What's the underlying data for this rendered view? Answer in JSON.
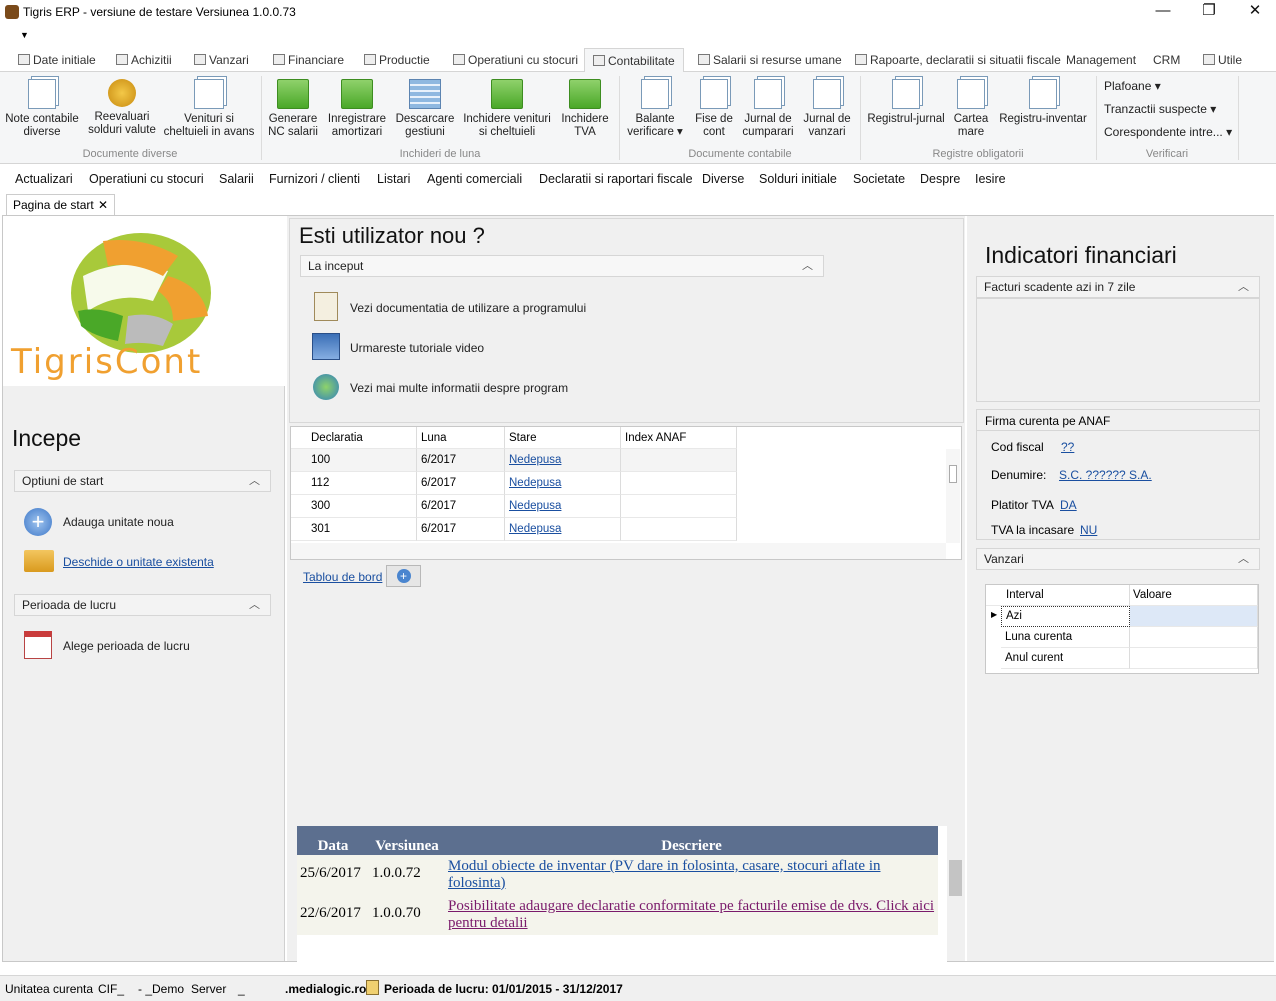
{
  "window": {
    "title": "Tigris ERP - versiune de testare Versiunea 1.0.0.73",
    "min": "—",
    "max": "❐",
    "close": "✕"
  },
  "ribbon_tabs": [
    "Date initiale",
    "Achizitii",
    "Vanzari",
    "Financiare",
    "Productie",
    "Operatiuni cu stocuri",
    "Contabilitate",
    "Salarii si resurse umane",
    "Rapoarte, declaratii si situatii fiscale",
    "Management",
    "CRM",
    "Utile"
  ],
  "ribbon_groups": {
    "documente_diverse": {
      "name": "Documente diverse",
      "btns": [
        [
          "Note contabile",
          "diverse"
        ],
        [
          "Reevaluari",
          "solduri valute"
        ],
        [
          "Venituri si",
          "cheltuieli in avans"
        ]
      ]
    },
    "inchideri": {
      "name": "Inchideri de luna",
      "btns": [
        [
          "Generare",
          "NC salarii"
        ],
        [
          "Inregistrare",
          "amortizari"
        ],
        [
          "Descarcare",
          "gestiuni"
        ],
        [
          "Inchidere venituri",
          "si cheltuieli"
        ],
        [
          "Inchidere",
          "TVA"
        ]
      ]
    },
    "documente_contabile": {
      "name": "Documente contabile",
      "btns": [
        [
          "Balante",
          "verificare ▾"
        ],
        [
          "Fise de",
          "cont"
        ],
        [
          "Jurnal de",
          "cumparari"
        ],
        [
          "Jurnal de",
          "vanzari"
        ]
      ]
    },
    "registre": {
      "name": "Registre obligatorii",
      "btns": [
        [
          "Registrul-jurnal",
          ""
        ],
        [
          "Cartea",
          "mare"
        ],
        [
          "Registru-inventar",
          ""
        ]
      ]
    },
    "verificari": {
      "name": "Verificari",
      "items": [
        "Plafoane ▾",
        "Tranzactii suspecte ▾",
        "Corespondente intre... ▾"
      ]
    }
  },
  "menubar": [
    "Actualizari",
    "Operatiuni cu stocuri",
    "Salarii",
    "Furnizori / clienti",
    "Listari",
    "Agenti comerciali",
    "Declaratii si raportari fiscale",
    "Diverse",
    "Solduri initiale",
    "Societate",
    "Despre",
    "Iesire"
  ],
  "doc_tab": {
    "label": "Pagina de start",
    "close": "✕"
  },
  "left": {
    "logo_text": "TigrisCont",
    "heading": "Incepe",
    "start_section": "Optiuni de start",
    "add_unit": "Adauga unitate noua",
    "open_unit": "Deschide o unitate existenta",
    "period_section": "Perioada de lucru",
    "choose_period": "Alege perioada de lucru"
  },
  "center": {
    "heading": "Esti utilizator nou ?",
    "section": "La inceput",
    "links": [
      "Vezi documentatia de utilizare a programului",
      "Urmareste tutoriale video",
      "Vezi mai multe informatii despre program"
    ],
    "grid_headers": [
      "Declaratia",
      "Luna",
      "Stare",
      "Index ANAF"
    ],
    "grid_rows": [
      [
        "100",
        "6/2017",
        "Nedepusa",
        ""
      ],
      [
        "112",
        "6/2017",
        "Nedepusa",
        ""
      ],
      [
        "300",
        "6/2017",
        "Nedepusa",
        ""
      ],
      [
        "301",
        "6/2017",
        "Nedepusa",
        ""
      ]
    ],
    "dashboard_link": "Tablou de bord",
    "news_headers": [
      "Data",
      "Versiunea",
      "Descriere"
    ],
    "news": [
      {
        "date": "25/6/2017",
        "version": "1.0.0.72",
        "desc": "Modul obiecte de inventar (PV dare in folosinta, casare, stocuri aflate in folosinta)"
      },
      {
        "date": "22/6/2017",
        "version": "1.0.0.70",
        "desc": "Posibilitate adaugare declaratie conformitate pe facturile emise de dvs. Click aici pentru detalii"
      }
    ]
  },
  "right": {
    "heading": "Indicatori financiari",
    "invoices_section": "Facturi scadente azi in 7 zile",
    "anaf_section": "Firma curenta pe ANAF",
    "cod_fiscal_label": "Cod fiscal",
    "cod_fiscal_value": "??",
    "denumire_label": "Denumire:",
    "denumire_value": "S.C. ?????? S.A.",
    "platitor_label": "Platitor TVA",
    "platitor_value": "DA",
    "incasare_label": "TVA la incasare",
    "incasare_value": "NU",
    "sales_section": "Vanzari",
    "sales_headers": [
      "Interval",
      "Valoare"
    ],
    "sales_rows": [
      "Azi",
      "Luna curenta",
      "Anul curent"
    ]
  },
  "status": {
    "unit_label": "Unitatea curenta",
    "cif": "CIF_",
    "demo": "- _Demo",
    "server_label": "Server",
    "server_value": "_",
    "host": ".medialogic.ro",
    "period": "Perioada de lucru: 01/01/2015 - 31/12/2017"
  },
  "colors": {
    "news_header": "#5c6f8f",
    "link": "#1a4fa0",
    "green_btn": "#4aa828"
  }
}
